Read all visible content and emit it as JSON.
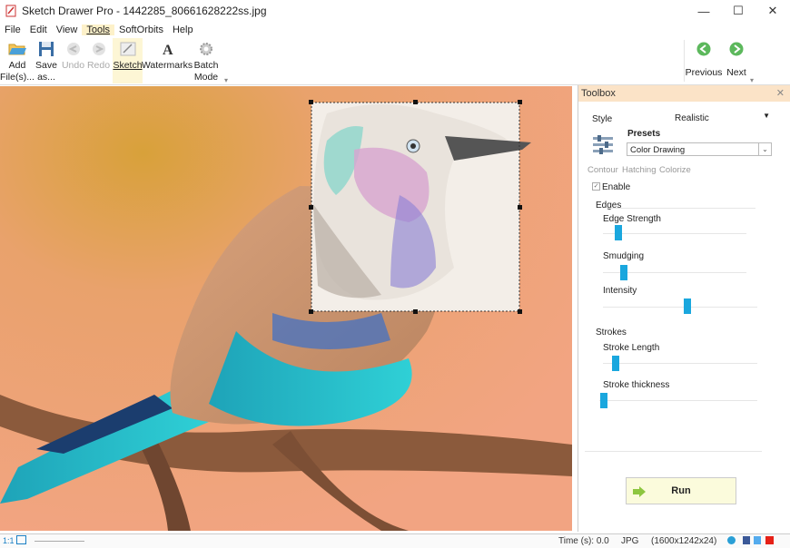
{
  "window": {
    "title": "Sketch Drawer Pro - 1442285_80661628222ss.jpg",
    "minimize": "—",
    "maximize": "☐",
    "close": "✕"
  },
  "menu": [
    "File",
    "Edit",
    "View",
    "Tools",
    "SoftOrbits",
    "Help"
  ],
  "ribbon": {
    "add": "Add\nFile(s)...",
    "save": "Save\nas...",
    "undo": "Undo",
    "redo": "Redo",
    "sketch": "Sketch",
    "watermarks": "Watermarks",
    "batch": "Batch\nMode",
    "previous": "Previous",
    "next": "Next"
  },
  "toolbox": {
    "title": "Toolbox",
    "style_label": "Style",
    "style_value": "Realistic",
    "presets_label": "Presets",
    "presets_value": "Color Drawing",
    "tabs": [
      "Contour",
      "Hatching",
      "Colorize"
    ],
    "enable_label": "Enable",
    "enable_checked": true,
    "edges_label": "Edges",
    "strokes_label": "Strokes",
    "sliders": [
      {
        "label": "Edge Strength",
        "value": 0.08
      },
      {
        "label": "Smudging",
        "value": 0.12
      },
      {
        "label": "Intensity",
        "value": 0.61
      },
      {
        "label": "Stroke Length",
        "value": 0.08
      },
      {
        "label": "Stroke thickness",
        "value": 0.02
      }
    ],
    "run_label": "Run"
  },
  "status": {
    "time": "Time (s): 0.0",
    "format": "JPG",
    "dims": "(1600x1242x24)"
  },
  "colors": {
    "accent": "#1aa7de",
    "toolbox_header": "#fbe3c7",
    "run_bg": "#fbfbdc"
  }
}
